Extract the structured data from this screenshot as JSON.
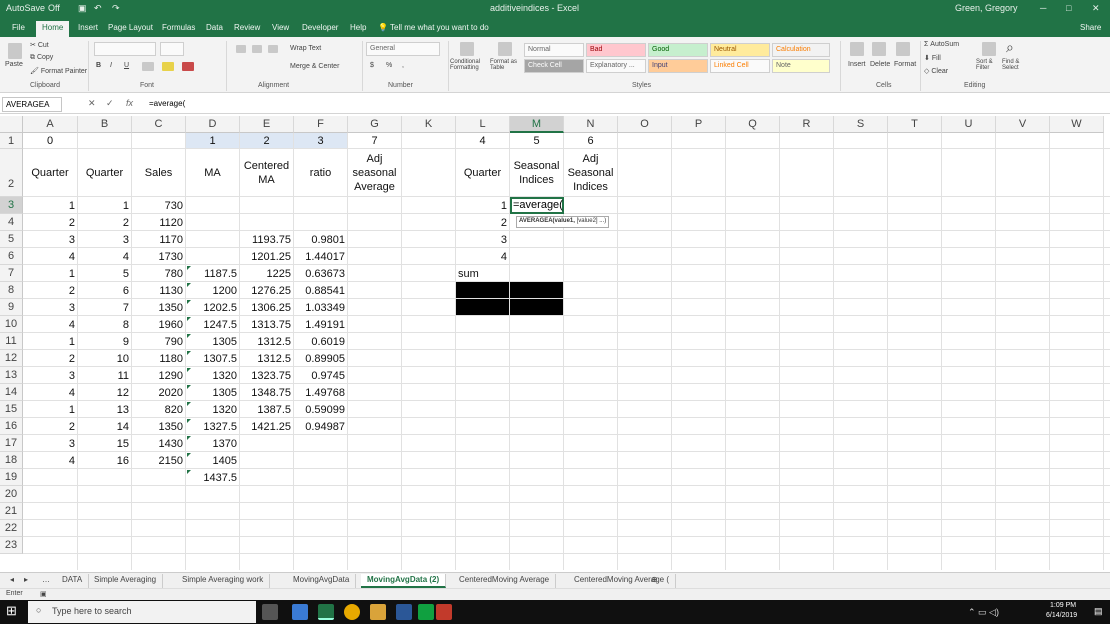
{
  "titlebar": {
    "autosave": "AutoSave",
    "autosave_state": "Off",
    "doc_title": "additiveindices - Excel",
    "user": "Green, Gregory"
  },
  "ribbon_tabs": [
    "File",
    "Home",
    "Insert",
    "Page Layout",
    "Formulas",
    "Data",
    "Review",
    "View",
    "Developer",
    "Help"
  ],
  "tell_me": "Tell me what you want to do",
  "share": "Share",
  "ribbon": {
    "clipboard": {
      "label": "Clipboard",
      "paste": "Paste",
      "cut": "Cut",
      "copy": "Copy",
      "format_painter": "Format Painter"
    },
    "font": {
      "label": "Font"
    },
    "alignment": {
      "label": "Alignment",
      "wrap_text": "Wrap Text",
      "merge_center": "Merge & Center"
    },
    "number": {
      "label": "Number",
      "format": "General"
    },
    "styles": {
      "label": "Styles",
      "conditional": "Conditional Formatting",
      "format_table": "Format as Table",
      "items": [
        "Normal",
        "Bad",
        "Good",
        "Neutral",
        "Calculation",
        "Check Cell",
        "Explanatory ...",
        "Input",
        "Linked Cell",
        "Note"
      ]
    },
    "cells": {
      "label": "Cells",
      "insert": "Insert",
      "delete": "Delete",
      "format": "Format"
    },
    "editing": {
      "label": "Editing",
      "autosum": "AutoSum",
      "fill": "Fill",
      "clear": "Clear",
      "sort_filter": "Sort & Filter",
      "find_select": "Find & Select"
    }
  },
  "formula_bar": {
    "name_box": "AVERAGEA",
    "formula": "=average("
  },
  "columns": [
    "A",
    "B",
    "C",
    "D",
    "E",
    "F",
    "G",
    "K",
    "L",
    "M",
    "N",
    "O",
    "P",
    "Q",
    "R",
    "S",
    "T",
    "U",
    "V",
    "W"
  ],
  "rows": [
    "1",
    "2",
    "3",
    "4",
    "5",
    "6",
    "7",
    "8",
    "9",
    "10",
    "11",
    "12",
    "13",
    "14",
    "15",
    "16",
    "17",
    "18",
    "19",
    "20",
    "21",
    "22",
    "23"
  ],
  "row1": {
    "A": "0",
    "D": "1",
    "E": "2",
    "F": "3",
    "G": "7",
    "L": "4",
    "M": "5",
    "N": "6"
  },
  "headers": {
    "A": "Quarter",
    "B": "Quarter",
    "C": "Sales",
    "D": "MA",
    "E": "Centered MA",
    "F": "ratio",
    "G": "Adj seasonal Average",
    "L": "Quarter",
    "M": "Seasonal Indices",
    "N": "Adj Seasonal Indices"
  },
  "table": {
    "A": [
      "1",
      "2",
      "3",
      "4",
      "1",
      "2",
      "3",
      "4",
      "1",
      "2",
      "3",
      "4",
      "1",
      "2",
      "3",
      "4"
    ],
    "B": [
      "1",
      "2",
      "3",
      "4",
      "5",
      "6",
      "7",
      "8",
      "9",
      "10",
      "11",
      "12",
      "13",
      "14",
      "15",
      "16"
    ],
    "C": [
      "730",
      "1120",
      "1170",
      "1730",
      "780",
      "1130",
      "1350",
      "1960",
      "790",
      "1180",
      "1290",
      "2020",
      "820",
      "1350",
      "1430",
      "2150"
    ],
    "D": [
      "",
      "",
      "",
      "",
      "1187.5",
      "1200",
      "1202.5",
      "1247.5",
      "1305",
      "1307.5",
      "1320",
      "1305",
      "1320",
      "1327.5",
      "1370",
      "1405",
      "1437.5"
    ],
    "E": [
      "",
      "",
      "1193.75",
      "1201.25",
      "1225",
      "1276.25",
      "1306.25",
      "1313.75",
      "1312.5",
      "1312.5",
      "1323.75",
      "1348.75",
      "1387.5",
      "1421.25"
    ],
    "F": [
      "",
      "",
      "0.9801",
      "1.44017",
      "0.63673",
      "0.88541",
      "1.03349",
      "1.49191",
      "0.6019",
      "0.89905",
      "0.9745",
      "1.49768",
      "0.59099",
      "0.94987"
    ]
  },
  "right_table": {
    "quarters": [
      "1",
      "2",
      "3",
      "4"
    ],
    "sum_label": "sum",
    "editing_value": "=average("
  },
  "tooltip": {
    "arg1": "AVERAGEA(value1,",
    "arg2": "[value2]",
    "more": "...)"
  },
  "sheets": [
    "DATA",
    "Simple Averaging",
    "Simple Averaging work",
    "MovingAvgData",
    "MovingAvgData (2)",
    "CenteredMoving Average",
    "CenteredMoving Average ("
  ],
  "active_sheet": "MovingAvgData (2)",
  "status": {
    "mode": "Enter"
  },
  "taskbar": {
    "search": "Type here to search",
    "time": "1:09 PM",
    "date": "6/14/2019"
  }
}
